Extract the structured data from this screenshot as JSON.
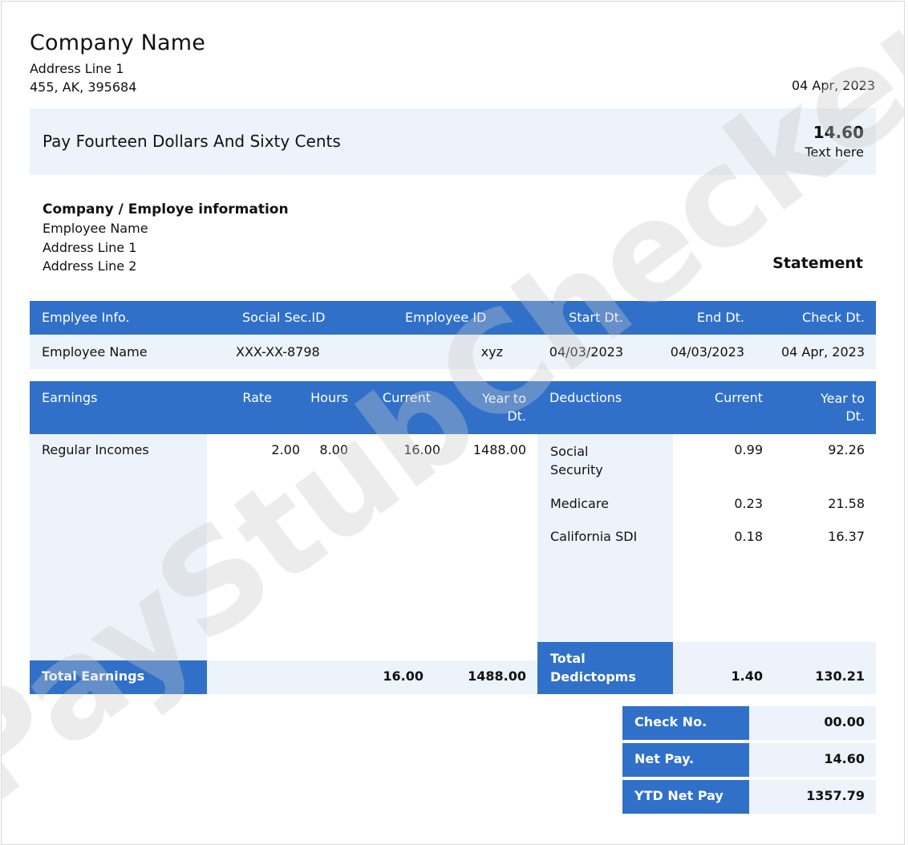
{
  "company": {
    "name": "Company Name",
    "address_line1": "Address Line 1",
    "address_line2": "455, AK, 395684",
    "date": "04 Apr, 2023"
  },
  "pay": {
    "amount_words": "Pay Fourteen Dollars And Sixty Cents",
    "amount": "14.60",
    "note": "Text here"
  },
  "info": {
    "title": "Company / Employe information",
    "employee_name": "Employee Name",
    "address_line1": "Address Line 1",
    "address_line2": "Address Line 2",
    "statement": "Statement"
  },
  "employee_table": {
    "headers": [
      "Emplyee Info.",
      "Social Sec.ID",
      "Employee ID",
      "Start Dt.",
      "End Dt.",
      "Check Dt."
    ],
    "row": [
      "Employee Name",
      "XXX-XX-8798",
      "xyz",
      "04/03/2023",
      "04/03/2023",
      "04 Apr, 2023"
    ]
  },
  "earnings": {
    "headers": {
      "earnings": "Earnings",
      "rate": "Rate",
      "hours": "Hours",
      "current": "Current",
      "ytd": "Year to Dt."
    },
    "rows": [
      {
        "name": "Regular Incomes",
        "rate": "2.00",
        "hours": "8.00",
        "current": "16.00",
        "ytd": "1488.00"
      }
    ],
    "total_label": "Total Earnings",
    "total_current": "16.00",
    "total_ytd": "1488.00"
  },
  "deductions": {
    "headers": {
      "deductions": "Deductions",
      "current": "Current",
      "ytd": "Year to Dt."
    },
    "rows": [
      {
        "name": "Social Security",
        "current": "0.99",
        "ytd": "92.26"
      },
      {
        "name": "Medicare",
        "current": "0.23",
        "ytd": "21.58"
      },
      {
        "name": "California SDI",
        "current": "0.18",
        "ytd": "16.37"
      }
    ],
    "total_label": "Total Dedictopms",
    "total_current": "1.40",
    "total_ytd": "130.21"
  },
  "summary": {
    "check_no_label": "Check No.",
    "check_no": "00.00",
    "net_pay_label": "Net Pay.",
    "net_pay": "14.60",
    "ytd_net_label": "YTD Net Pay",
    "ytd_net": "1357.79"
  },
  "watermark": "PayStubChecker",
  "colors": {
    "header_blue": "#3170c9",
    "light_blue": "#edf3fb",
    "watermark": "#c8c8c8"
  }
}
